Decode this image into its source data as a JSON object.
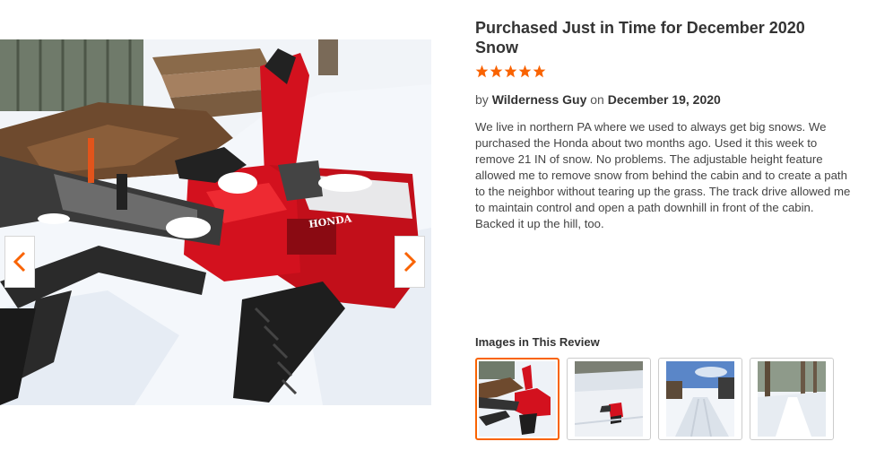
{
  "review": {
    "title": "Purchased Just in Time for December 2020 Snow",
    "rating": 5,
    "rating_max": 5,
    "by_prefix": "by",
    "author": "Wilderness Guy",
    "on_text": "on",
    "date": "December 19, 2020",
    "body": "We live in northern PA where we used to always get big snows. We purchased the Honda about two months ago. Used it this week to remove 21 IN of snow. No problems. The adjustable height feature allowed me to remove snow from behind the cabin and to create a path to the neighbor without tearing up the grass. The track drive allowed me to maintain control and open a path downhill in front of the cabin. Backed it up the hill, too."
  },
  "gallery": {
    "heading": "Images in This Review",
    "selected_index": 0,
    "thumbnail_count": 4,
    "main_image_brand_text": "HONDA"
  },
  "colors": {
    "accent": "#f96302",
    "star": "#f96302",
    "snowblower_red": "#d3111e"
  },
  "icons": {
    "prev": "chevron-left-icon",
    "next": "chevron-right-icon",
    "star": "star-icon"
  }
}
